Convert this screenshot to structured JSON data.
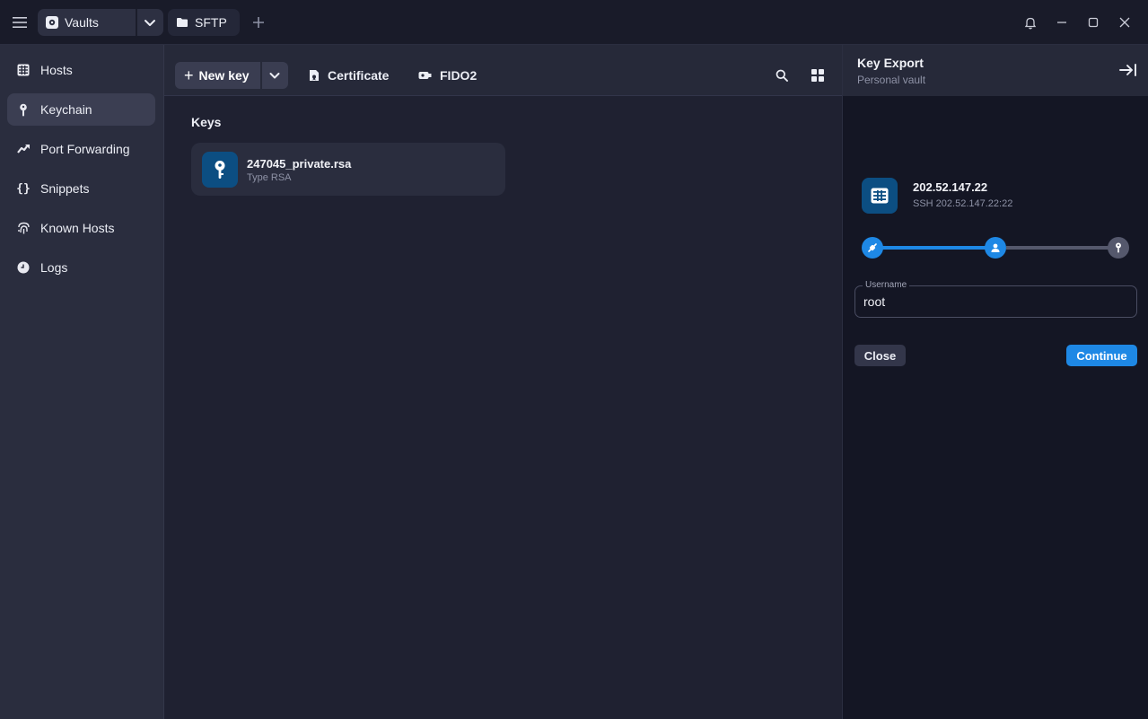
{
  "titlebar": {
    "tabs": [
      {
        "label": "Vaults",
        "icon": "vault-icon"
      },
      {
        "label": "SFTP",
        "icon": "folder-icon"
      }
    ],
    "add_tab_icon": "plus-icon",
    "window_controls": [
      "bell-icon",
      "minimize-icon",
      "maximize-icon",
      "close-icon"
    ]
  },
  "sidebar": {
    "items": [
      {
        "label": "Hosts",
        "icon": "hosts-grid-icon",
        "active": false
      },
      {
        "label": "Keychain",
        "icon": "key-icon",
        "active": true
      },
      {
        "label": "Port Forwarding",
        "icon": "port-forwarding-icon",
        "active": false
      },
      {
        "label": "Snippets",
        "icon": "braces-icon",
        "active": false
      },
      {
        "label": "Known Hosts",
        "icon": "fingerprint-icon",
        "active": false
      },
      {
        "label": "Logs",
        "icon": "clock-icon",
        "active": false
      }
    ]
  },
  "toolbar": {
    "new_key_label": "New key",
    "certificate_label": "Certificate",
    "fido2_label": "FIDO2"
  },
  "keys": {
    "section_title": "Keys",
    "items": [
      {
        "name": "247045_private.rsa",
        "subtitle": "Type RSA"
      }
    ]
  },
  "panel": {
    "title": "Key Export",
    "subtitle": "Personal vault",
    "host": {
      "name": "202.52.147.22",
      "subtitle": "SSH 202.52.147.22:22"
    },
    "steps": [
      "connect",
      "user",
      "key"
    ],
    "current_step": 2,
    "username_label": "Username",
    "username_value": "root",
    "close_label": "Close",
    "continue_label": "Continue"
  },
  "colors": {
    "accent": "#1e88e5",
    "icon_bg": "#0c4e82",
    "sidebar_bg": "#2a2d3e",
    "main_bg": "#1f2131",
    "panel_bg": "#141624"
  }
}
